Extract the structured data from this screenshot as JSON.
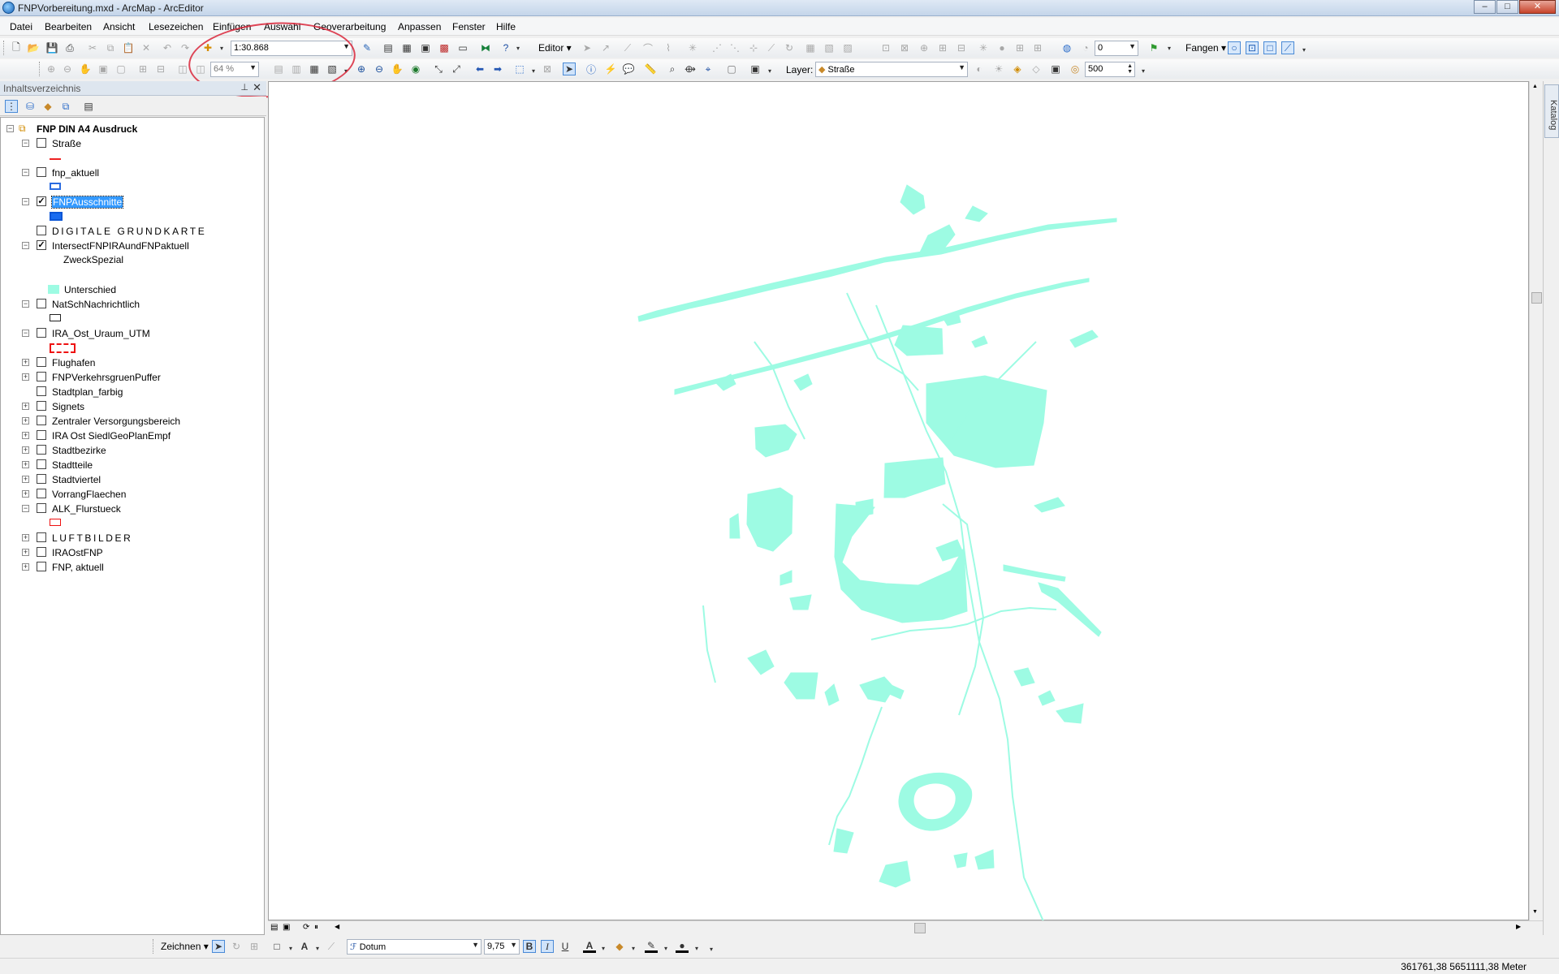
{
  "window": {
    "title": "FNPVorbereitung.mxd - ArcMap - ArcEditor",
    "min": "–",
    "max": "□",
    "close": "✕"
  },
  "menu": [
    "Datei",
    "Bearbeiten",
    "Ansicht",
    "Lesezeichen",
    "Einfügen",
    "Auswahl",
    "Geoverarbeitung",
    "Anpassen",
    "Fenster",
    "Hilfe"
  ],
  "toolbar": {
    "scale": "1:30.868",
    "zoom_percent": "64 %",
    "editor_label": "Editor ▾",
    "sketch_value": "0",
    "snapping_label": "Fangen ▾",
    "layer_label": "Layer:",
    "layer_value": "Straße",
    "buffer_value": "500"
  },
  "toc": {
    "title": "Inhaltsverzeichnis",
    "dataframe": "FNP DIN A4 Ausdruck",
    "layers": [
      {
        "label": "Straße",
        "expand": "−",
        "checked": false,
        "legend": "line-red"
      },
      {
        "label": "fnp_aktuell",
        "expand": "−",
        "checked": false,
        "legend": "box-blue"
      },
      {
        "label": "FNPAusschnitte",
        "expand": "−",
        "checked": true,
        "selected": true,
        "legend": "box-blue-fill"
      },
      {
        "label": "DIGITALE GRUNDKARTE",
        "expand": "",
        "checked": false,
        "spaced": true
      },
      {
        "label": "IntersectFNPIRAundFNPaktuell",
        "expand": "−",
        "checked": true,
        "sub": "ZweckSpezial",
        "legend": "Unterschied"
      },
      {
        "label": "NatSchNachrichtlich",
        "expand": "−",
        "checked": false,
        "legend": "box-black"
      },
      {
        "label": "IRA_Ost_Uraum_UTM",
        "expand": "−",
        "checked": false,
        "legend": "box-red-dash"
      },
      {
        "label": "Flughafen",
        "expand": "+",
        "checked": false
      },
      {
        "label": "FNPVerkehrsgruenPuffer",
        "expand": "+",
        "checked": false
      },
      {
        "label": "Stadtplan_farbig",
        "expand": "",
        "checked": false
      },
      {
        "label": "Signets",
        "expand": "+",
        "checked": false
      },
      {
        "label": "Zentraler Versorgungsbereich",
        "expand": "+",
        "checked": false
      },
      {
        "label": "IRA Ost SiedlGeoPlanEmpf",
        "expand": "+",
        "checked": false
      },
      {
        "label": "Stadtbezirke",
        "expand": "+",
        "checked": false
      },
      {
        "label": "Stadtteile",
        "expand": "+",
        "checked": false
      },
      {
        "label": "Stadtviertel",
        "expand": "+",
        "checked": false
      },
      {
        "label": "VorrangFlaechen",
        "expand": "+",
        "checked": false
      },
      {
        "label": "ALK_Flurstueck",
        "expand": "−",
        "checked": false,
        "legend": "box-red"
      },
      {
        "label": "LUFTBILDER",
        "expand": "+",
        "checked": false,
        "spaced": true
      },
      {
        "label": "IRAOstFNP",
        "expand": "+",
        "checked": false
      },
      {
        "label": "FNP, aktuell",
        "expand": "+",
        "checked": false
      }
    ]
  },
  "catalog_tab": "Katalog",
  "drawing": {
    "zeichnen": "Zeichnen ▾",
    "font_name": "Dotum",
    "font_size": "9,75",
    "bold": "B",
    "italic": "I",
    "underline": "U"
  },
  "status": {
    "coords": "361761,38  5651111,38 Meter"
  },
  "colors": {
    "feature_fill": "#9dfbe3",
    "selection": "#3399ff",
    "annotation": "#d9263a"
  }
}
